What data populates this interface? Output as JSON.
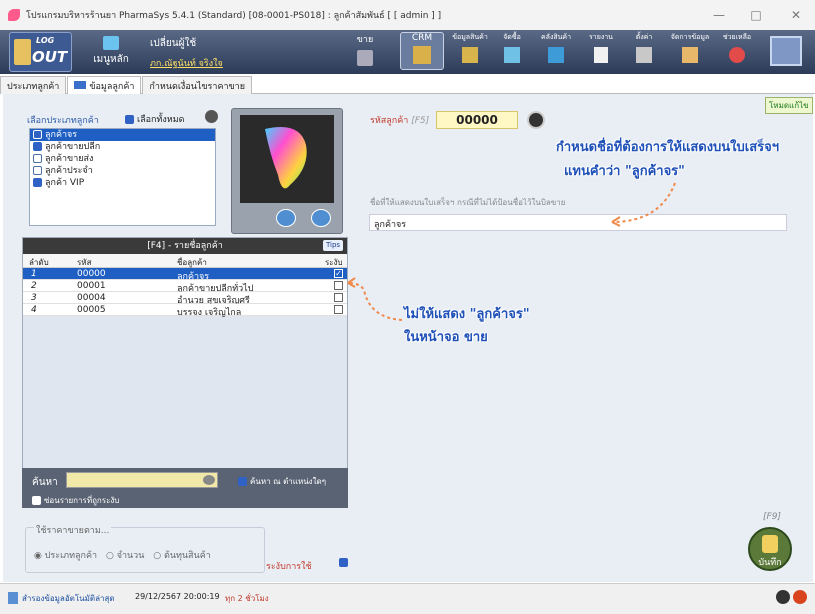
{
  "window": {
    "title": "โปรแกรมบริหารร้านยา PharmaSys 5.4.1 (Standard) [08-0001-PS018] : ลูกค้าสัมพันธ์ [ [ admin ] ]",
    "min": "—",
    "max": "□",
    "close": "✕"
  },
  "toolbar": {
    "logout_top": "LOG",
    "logout_bottom": "OUT",
    "home_label": "เมนูหลัก",
    "user_label": "เปลี่ยนผู้ใช้",
    "user_name": "ภก.ณัฐนันท์ จริงใจ",
    "sell": "ขาย",
    "crm": "CRM",
    "product_data": "ข้อมูลสินค้า",
    "purchase": "จัดซื้อ",
    "inventory": "คลังสินค้า",
    "report": "รายงาน",
    "settings": "ตั้งค่า",
    "manage_data": "จัดการข้อมูล",
    "help": "ช่วยเหลือ"
  },
  "tabs": [
    "ประเภทลูกค้า",
    "ข้อมูลลูกค้า",
    "กำหนดเงื่อนไขราคาขาย"
  ],
  "mode": "โหมดแก้ไข",
  "type_section": {
    "label": "เลือกประเภทลูกค้า",
    "select_all": "เลือกทั้งหมด",
    "items": [
      {
        "label": "ลูกค้าจร",
        "checked": true,
        "selected": true
      },
      {
        "label": "ลูกค้าขายปลีก",
        "checked": true,
        "selected": false
      },
      {
        "label": "ลูกค้าขายส่ง",
        "checked": false,
        "selected": false
      },
      {
        "label": "ลูกค้าประจำ",
        "checked": false,
        "selected": false
      },
      {
        "label": "ลูกค้า VIP",
        "checked": true,
        "selected": false
      }
    ]
  },
  "customer_list": {
    "header": "[F4] - รายชื่อลูกค้า",
    "tips": "Tips",
    "columns": [
      "ลำดับ",
      "รหัส",
      "ชื่อลูกค้า",
      "ระงับ"
    ],
    "rows": [
      {
        "no": "1",
        "code": "00000",
        "name": "ลูกค้าจร",
        "suspended": true,
        "selected": true
      },
      {
        "no": "2",
        "code": "00001",
        "name": "ลูกค้าขายปลีกทั่วไป",
        "suspended": false,
        "selected": false
      },
      {
        "no": "3",
        "code": "00004",
        "name": "อำนวย สุขเจริญศรี",
        "suspended": false,
        "selected": false
      },
      {
        "no": "4",
        "code": "00005",
        "name": "บรรจง เจริญไกล",
        "suspended": false,
        "selected": false
      }
    ]
  },
  "search": {
    "label": "ค้นหา",
    "any_pos": "ค้นหา ณ ตำแหน่งใดๆ",
    "hide_suspended": "ซ่อนรายการที่ถูกระงับ"
  },
  "price": {
    "legend": "ใช้ราคาขายตาม...",
    "opt1": "ประเภทลูกค้า",
    "opt2": "จำนวน",
    "opt3": "ต้นทุนสินค้า",
    "use_label": "ระงับการใช้"
  },
  "detail": {
    "code_label": "รหัสลูกค้า",
    "code_key": "[F5]",
    "code_value": "00000",
    "name_label": "ชื่อที่ให้แสดงบนใบเสร็จฯ กรณีที่ไม่ได้ป้อนชื่อไว้ในบิลขาย",
    "name_value": "ลูกค้าจร"
  },
  "annotations": {
    "top1": "กำหนดชื่อที่ต้องการให้แสดงบนใบเสร็จฯ",
    "top2": "แทนคำว่า \"ลูกค้าจร\"",
    "mid1": "ไม่ให้แสดง \"ลูกค้าจร\"",
    "mid2": "ในหน้าจอ ขาย"
  },
  "save": {
    "key": "[F9]",
    "label": "บันทึก"
  },
  "status": {
    "text": "สำรองข้อมูลอัตโนมัติล่าสุด",
    "date": "29/12/2567 20:00:19",
    "ago": "ทุก 2 ชั่วโมง"
  },
  "colors": {
    "accent": "#1f5fc4",
    "annot": "#1e50b8",
    "arrow": "#f08a4b"
  }
}
